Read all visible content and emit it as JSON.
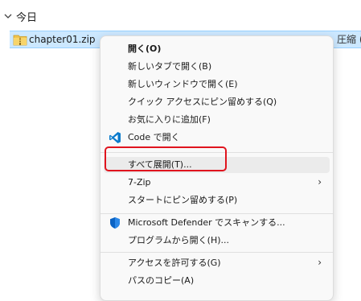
{
  "group": {
    "label": "今日"
  },
  "file": {
    "name": "chapter01.zip",
    "type": "圧縮 ("
  },
  "menu": {
    "items": [
      {
        "label": "開く(O)",
        "icon": "",
        "submenu": false
      },
      {
        "label": "新しいタブで開く(B)",
        "icon": "",
        "submenu": false
      },
      {
        "label": "新しいウィンドウで開く(E)",
        "icon": "",
        "submenu": false
      },
      {
        "label": "クイック アクセスにピン留めする(Q)",
        "icon": "",
        "submenu": false
      },
      {
        "label": "お気に入りに追加(F)",
        "icon": "",
        "submenu": false
      },
      {
        "label": "Code で開く",
        "icon": "vscode-icon",
        "submenu": false
      },
      {
        "label": "すべて展開(T)...",
        "icon": "",
        "submenu": false
      },
      {
        "label": "7-Zip",
        "icon": "",
        "submenu": true
      },
      {
        "label": "スタートにピン留めする(P)",
        "icon": "",
        "submenu": false
      },
      {
        "label": "Microsoft Defender でスキャンする...",
        "icon": "defender-shield-icon",
        "submenu": false
      },
      {
        "label": "プログラムから開く(H)...",
        "icon": "",
        "submenu": false
      },
      {
        "label": "アクセスを許可する(G)",
        "icon": "",
        "submenu": true
      },
      {
        "label": "パスのコピー(A)",
        "icon": "",
        "submenu": false
      }
    ],
    "submenu_glyph": "›"
  },
  "colors": {
    "selection": "#cce8ff",
    "highlight_border": "#e0141e",
    "vscode_blue": "#0a7acc",
    "defender_blue": "#0b63c4"
  }
}
